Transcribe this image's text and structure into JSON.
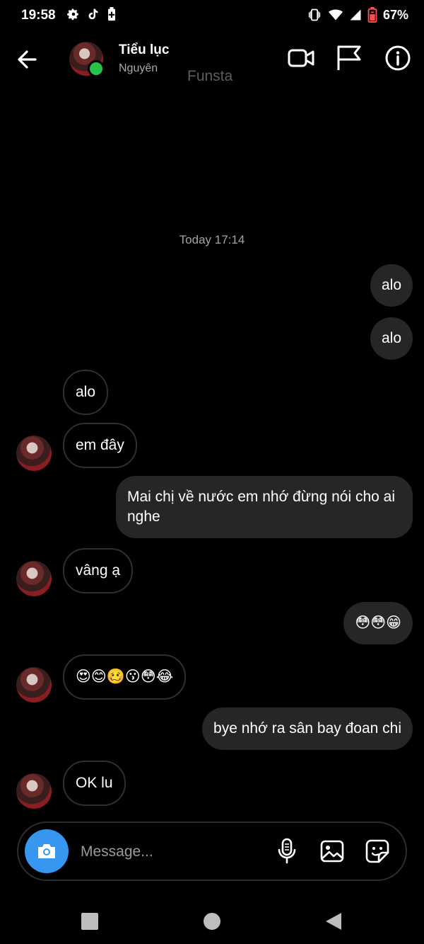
{
  "status_bar": {
    "time": "19:58",
    "battery": "67%",
    "left_icons": [
      "gear-icon",
      "tiktok-icon",
      "battery-saver-icon"
    ],
    "right_icons": [
      "vibrate-icon",
      "wifi-icon",
      "signal-icon",
      "battery-icon"
    ]
  },
  "header": {
    "contact_name": "Tiểu lục",
    "contact_sub": "Nguyên",
    "app_label": "Funsta",
    "online": true,
    "online_color": "#27c24c"
  },
  "chat": {
    "timestamp": "Today 17:14",
    "messages": [
      {
        "from": "me",
        "text": "alo"
      },
      {
        "from": "me",
        "text": "alo"
      },
      {
        "from": "them",
        "text": "alo"
      },
      {
        "from": "them",
        "text": "em đây"
      },
      {
        "from": "me",
        "text": "Mai chị về nước em nhớ đừng nói cho ai nghe"
      },
      {
        "from": "them",
        "text": "vâng ạ"
      },
      {
        "from": "me",
        "text": "😳😳😁"
      },
      {
        "from": "them",
        "text": "😍😊🥴😗😳😂"
      },
      {
        "from": "me",
        "text": "bye nhớ ra sân bay đoan chi"
      },
      {
        "from": "them",
        "text": "OK lu"
      }
    ]
  },
  "composer": {
    "placeholder": "Message...",
    "accent": "#3797f0"
  },
  "colors": {
    "background": "#000000",
    "outgoing_bubble": "#262626",
    "incoming_border": "#2f2f2f"
  }
}
